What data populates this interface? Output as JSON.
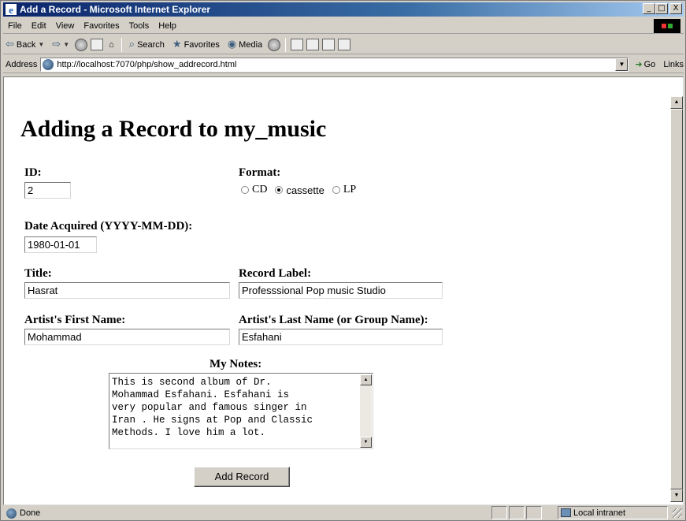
{
  "window": {
    "title": "Add a Record - Microsoft Internet Explorer",
    "controls": {
      "minimize": "_",
      "maximize": "□",
      "close": "X"
    }
  },
  "menu": [
    "File",
    "Edit",
    "View",
    "Favorites",
    "Tools",
    "Help"
  ],
  "toolbar": {
    "back": "Back",
    "search": "Search",
    "favorites": "Favorites",
    "media": "Media"
  },
  "address": {
    "label": "Address",
    "url": "http://localhost:7070/php/show_addrecord.html",
    "go": "Go",
    "links": "Links"
  },
  "page": {
    "heading": "Adding a Record to my_music",
    "id_label": "ID:",
    "id_value": "2",
    "format_label": "Format:",
    "format_options": [
      "CD",
      "cassette",
      "LP"
    ],
    "format_selected": "cassette",
    "date_label": "Date Acquired (YYYY-MM-DD):",
    "date_value": "1980-01-01",
    "title_label": "Title:",
    "title_value": "Hasrat",
    "record_label_label": "Record Label:",
    "record_label_value": "Professsional Pop music Studio",
    "first_name_label": "Artist's First Name:",
    "first_name_value": "Mohammad",
    "last_name_label": "Artist's Last Name (or Group Name):",
    "last_name_value": "Esfahani",
    "notes_label": "My Notes:",
    "notes_value": "This is second album of Dr.\nMohammad Esfahani. Esfahani is\nvery popular and famous singer in\nIran . He signs at Pop and Classic\nMethods. I love him a lot.",
    "submit_label": "Add Record"
  },
  "status": {
    "text": "Done",
    "zone": "Local intranet"
  },
  "colors": {
    "titlebar_start": "#0a246a",
    "titlebar_end": "#a6caf0",
    "chrome": "#d4d0c8"
  }
}
